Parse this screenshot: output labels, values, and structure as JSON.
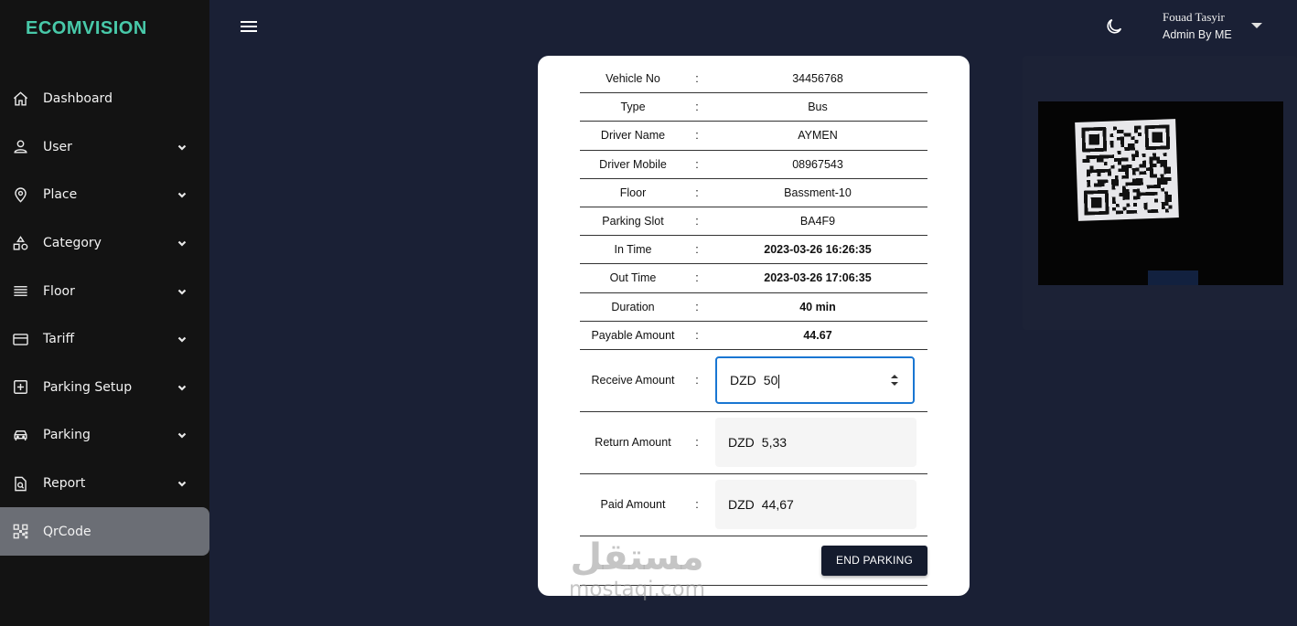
{
  "brand": "ECOMVISION",
  "nav": [
    {
      "label": "Dashboard",
      "icon": "home-icon",
      "chevron": false,
      "active": false
    },
    {
      "label": "User",
      "icon": "user-icon",
      "chevron": true,
      "active": false
    },
    {
      "label": "Place",
      "icon": "map-pin-icon",
      "chevron": true,
      "active": false
    },
    {
      "label": "Category",
      "icon": "shapes-icon",
      "chevron": true,
      "active": false
    },
    {
      "label": "Floor",
      "icon": "list-lines-icon",
      "chevron": true,
      "active": false
    },
    {
      "label": "Tariff",
      "icon": "credit-card-icon",
      "chevron": true,
      "active": false
    },
    {
      "label": "Parking Setup",
      "icon": "add-box-icon",
      "chevron": true,
      "active": false
    },
    {
      "label": "Parking",
      "icon": "car-icon",
      "chevron": true,
      "active": false
    },
    {
      "label": "Report",
      "icon": "document-search-icon",
      "chevron": true,
      "active": false
    },
    {
      "label": "QrCode",
      "icon": "qr-code-icon",
      "chevron": false,
      "active": true
    }
  ],
  "header": {
    "user_name": "Fouad Tasyir",
    "user_role": "Admin By ME"
  },
  "details": {
    "separator": ":",
    "rows": [
      {
        "label": "Vehicle No",
        "value": "34456768",
        "bold": false
      },
      {
        "label": "Type",
        "value": "Bus",
        "bold": false
      },
      {
        "label": "Driver Name",
        "value": "AYMEN",
        "bold": false
      },
      {
        "label": "Driver Mobile",
        "value": "08967543",
        "bold": false
      },
      {
        "label": "Floor",
        "value": "Bassment-10",
        "bold": false
      },
      {
        "label": "Parking Slot",
        "value": "BA4F9",
        "bold": false
      },
      {
        "label": "In Time",
        "value": "2023-03-26 16:26:35",
        "bold": true
      },
      {
        "label": "Out Time",
        "value": "2023-03-26 17:06:35",
        "bold": true
      },
      {
        "label": "Duration",
        "value": "40 min",
        "bold": true
      },
      {
        "label": "Payable Amount",
        "value": "44.67",
        "bold": true
      }
    ],
    "receive": {
      "label": "Receive Amount",
      "currency": "DZD",
      "value": "50"
    },
    "return": {
      "label": "Return Amount",
      "currency": "DZD",
      "value": "5,33"
    },
    "paid": {
      "label": "Paid Amount",
      "currency": "DZD",
      "value": "44,67"
    },
    "end_button": "END PARKING"
  },
  "watermark": {
    "arabic": "مستقل",
    "latin": "mostaqi.com"
  },
  "colors": {
    "background": "#1a2035",
    "sidebar": "#131313",
    "brand": "#48c9a9",
    "active_item": "#6b6e75",
    "button": "#141b2d",
    "focus": "#1976d2"
  }
}
